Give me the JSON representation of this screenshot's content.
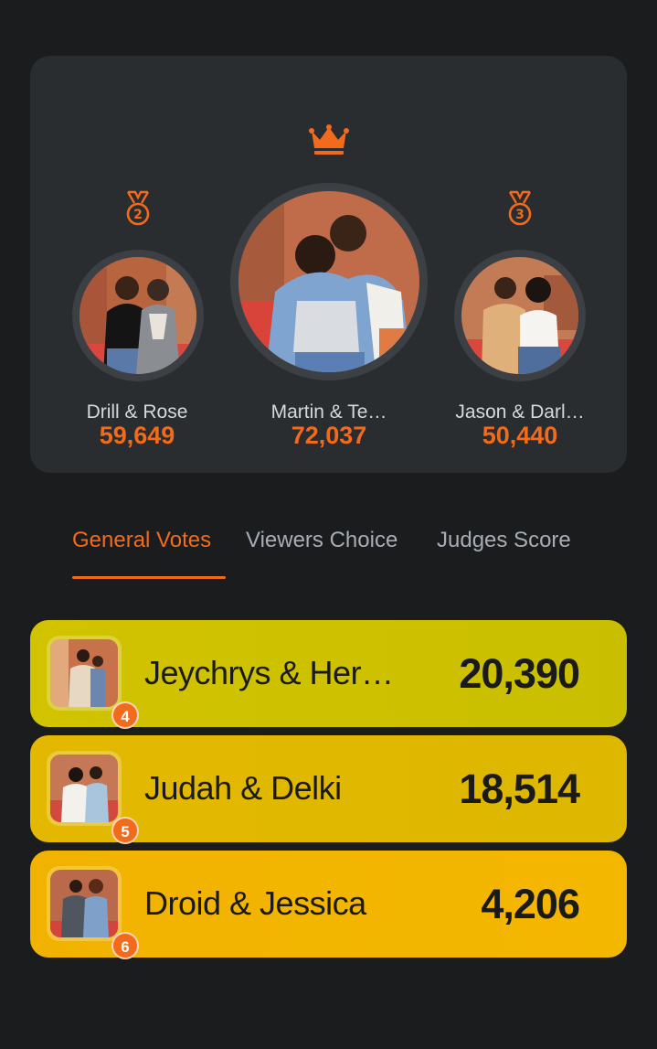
{
  "colors": {
    "accent": "#f26a1b",
    "card": "#2a2d30",
    "background": "#1b1c1e",
    "row_colors": [
      "#cdc100",
      "#e2b800",
      "#f3b600"
    ]
  },
  "podium": {
    "crown_icon": "crown-icon",
    "second": {
      "rank": "2",
      "name": "Drill & Rose",
      "votes": "59,649",
      "icon": "medal-icon"
    },
    "first": {
      "name": "Martin & Te…",
      "votes": "72,037"
    },
    "third": {
      "rank": "3",
      "name": "Jason & Darl…",
      "votes": "50,440",
      "icon": "medal-icon"
    }
  },
  "tabs": [
    {
      "label": "General Votes",
      "active": true
    },
    {
      "label": "Viewers Choice",
      "active": false
    },
    {
      "label": "Judges Score",
      "active": false
    }
  ],
  "leaderboard": [
    {
      "rank": "4",
      "name": "Jeychrys & Her…",
      "votes": "20,390"
    },
    {
      "rank": "5",
      "name": "Judah & Delki",
      "votes": "18,514"
    },
    {
      "rank": "6",
      "name": "Droid & Jessica",
      "votes": "4,206"
    }
  ]
}
